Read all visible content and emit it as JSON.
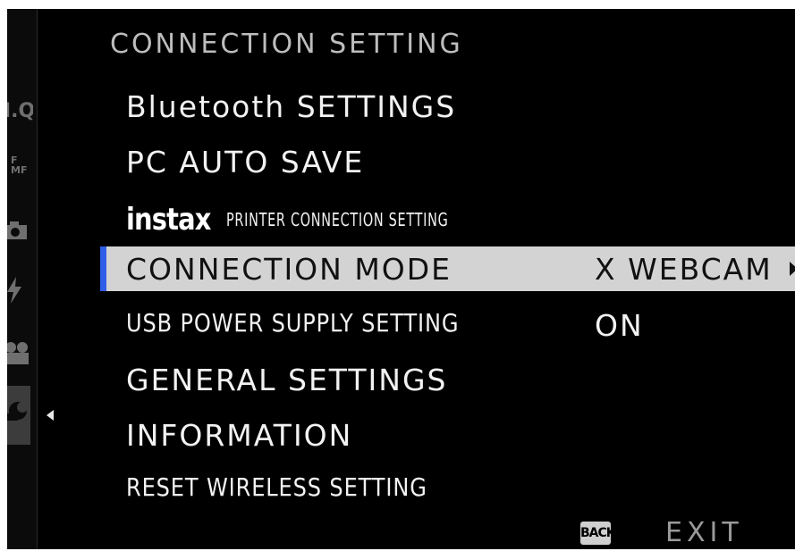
{
  "screen": {
    "title": "CONNECTION SETTING"
  },
  "sidebar": {
    "iq_label": "I.Q.",
    "fmf_label": "F\nMF",
    "icons": [
      "camera-icon",
      "flash-icon",
      "video-icon",
      "wrench-icon"
    ]
  },
  "menu": {
    "bluetooth": "Bluetooth SETTINGS",
    "pc_auto_save": "PC AUTO SAVE",
    "instax_logo": "instax",
    "instax_text": "PRINTER CONNECTION SETTING",
    "connection_mode": "CONNECTION MODE",
    "connection_mode_value": "X WEBCAM",
    "usb_power": "USB POWER SUPPLY SETTING",
    "usb_power_value": "ON",
    "general": "GENERAL SETTINGS",
    "information": "INFORMATION",
    "reset_wireless": "RESET WIRELESS SETTING"
  },
  "footer": {
    "back_badge": "BACK",
    "exit_label": "EXIT"
  },
  "colors": {
    "background": "#000000",
    "selected_row": "#d3d3d3",
    "selected_accent": "#2f5ee8",
    "text": "#f2f2f2",
    "title_text": "#bdbdbd"
  }
}
